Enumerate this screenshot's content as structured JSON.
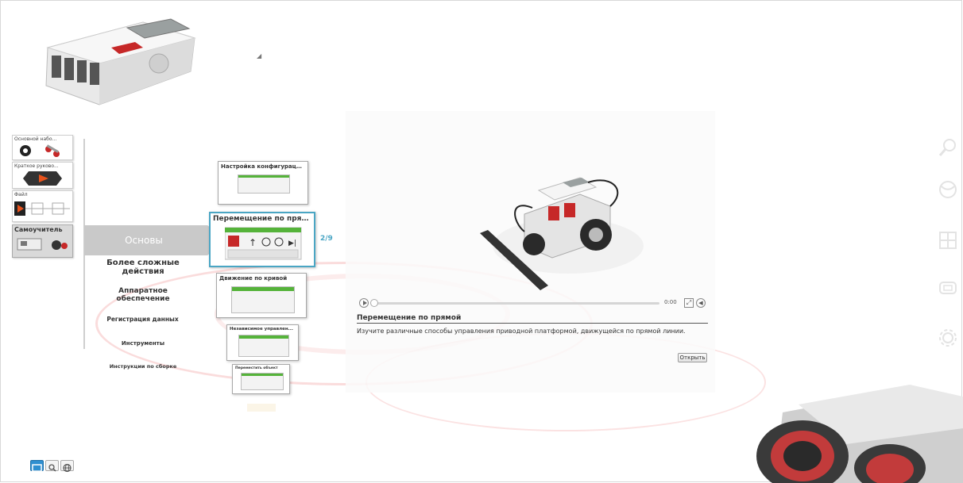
{
  "left_tiles": [
    {
      "label": "Основной набо..."
    },
    {
      "label": "Краткое руково..."
    },
    {
      "label": "Файл"
    },
    {
      "label": "Самоучитель"
    }
  ],
  "categories": {
    "active": "Основы",
    "items": [
      "Более сложные действия",
      "Аппаратное обеспечение",
      "Регистрация данных",
      "Инструменты",
      "Инструкции по сборке"
    ]
  },
  "lessons": [
    {
      "title": "Настройка конфигураци..."
    },
    {
      "title": "Перемещение по прямой"
    },
    {
      "title": "Движение по кривой"
    },
    {
      "title": "Независимое управлен..."
    },
    {
      "title": "Переместить объект"
    }
  ],
  "pager": "2/9",
  "preview": {
    "time": "0:00",
    "title": "Перемещение по прямой",
    "description": "Изучите различные способы управления приводной платформой, движущейся по прямой линии.",
    "open_label": "Открыть"
  },
  "right_rail": [
    "search-icon",
    "sphere-icon",
    "window-icon",
    "device-icon",
    "gear-icon"
  ],
  "view_buttons": [
    "list-view-icon",
    "search-icon",
    "globe-icon"
  ],
  "colors": {
    "accent": "#4aa6c4",
    "block_green": "#55b33a",
    "arrow_gray": "#c9c9c9",
    "view_on": "#2f8fd0"
  }
}
